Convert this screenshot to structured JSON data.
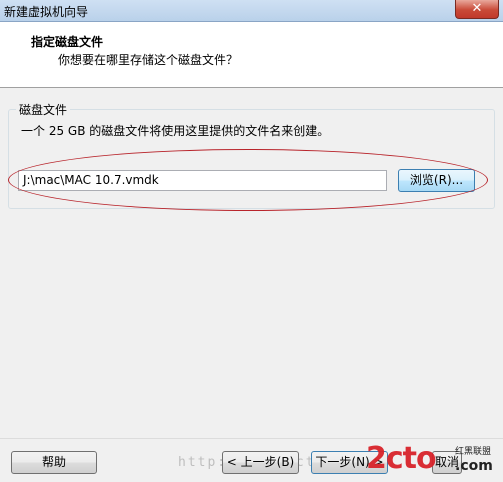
{
  "window": {
    "title": "新建虚拟机向导",
    "close_glyph": "✕"
  },
  "header": {
    "title": "指定磁盘文件",
    "subtitle": "你想要在哪里存储这个磁盘文件？"
  },
  "disk_group": {
    "label": "磁盘文件",
    "description": "一个 25 GB 的磁盘文件将使用这里提供的文件名来创建。",
    "file_value": "J:\\mac\\MAC 10.7.vmdk",
    "browse_label": "浏览(R)..."
  },
  "footer": {
    "help_label": "帮助",
    "back_label": "< 上一步(B)",
    "next_label": "下一步(N) >",
    "cancel_label": "取消"
  },
  "watermark": {
    "url": "http://www.2cto.com",
    "logo": "2cto",
    "cn_small": "红黑联盟",
    "cn_large": ".com"
  },
  "annotation": {
    "color": "#b8242b"
  }
}
